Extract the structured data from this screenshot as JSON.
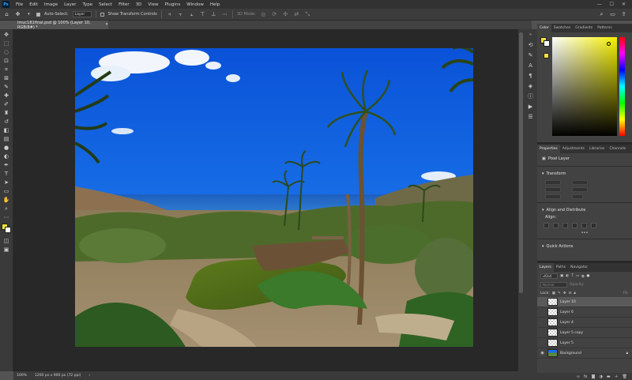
{
  "menubar": {
    "logo": "Ps",
    "items": [
      "File",
      "Edit",
      "Image",
      "Layer",
      "Type",
      "Select",
      "Filter",
      "3D",
      "View",
      "Plugins",
      "Window",
      "Help"
    ],
    "controls": [
      "—",
      "☐",
      "✕"
    ]
  },
  "options": {
    "auto_select_label": "Auto-Select:",
    "auto_select_value": "Layer",
    "show_transform_label": "Show Transform Controls",
    "mode_label": "3D Mode:"
  },
  "document": {
    "tab_title": "lmuc181final.psd @ 100% (Layer 10, RGB/8#) *",
    "close": "✕"
  },
  "status": {
    "zoom": "100%",
    "dimensions": "1200 px x 900 px (72 ppi)"
  },
  "color_panel": {
    "tabs": [
      "Color",
      "Swatches",
      "Gradients",
      "Patterns"
    ],
    "foreground": "#f5e13a",
    "background": "#ffffff"
  },
  "properties_panel": {
    "tabs": [
      "Properties",
      "Adjustments",
      "Libraries",
      "Channels"
    ],
    "layer_type": "Pixel Layer",
    "transform_title": "Transform",
    "align_title": "Align and Distribute",
    "align_label": "Align:",
    "quick_actions_title": "Quick Actions"
  },
  "layers_panel": {
    "tabs": [
      "Layers",
      "Paths",
      "Navigator"
    ],
    "kind_label": "Kind",
    "blend_mode": "Normal",
    "opacity_label": "Opacity:",
    "lock_label": "Lock:",
    "fill_label": "Fill:",
    "layers": [
      {
        "name": "Layer 10",
        "selected": true,
        "visible": false,
        "thumb": "transparent"
      },
      {
        "name": "Layer 6",
        "selected": false,
        "visible": false,
        "thumb": "transparent"
      },
      {
        "name": "Layer 4",
        "selected": false,
        "visible": false,
        "thumb": "transparent"
      },
      {
        "name": "Layer 5 copy",
        "selected": false,
        "visible": false,
        "thumb": "transparent"
      },
      {
        "name": "Layer 5",
        "selected": false,
        "visible": false,
        "thumb": "transparent"
      },
      {
        "name": "Background",
        "selected": false,
        "visible": true,
        "thumb": "photo"
      }
    ]
  }
}
